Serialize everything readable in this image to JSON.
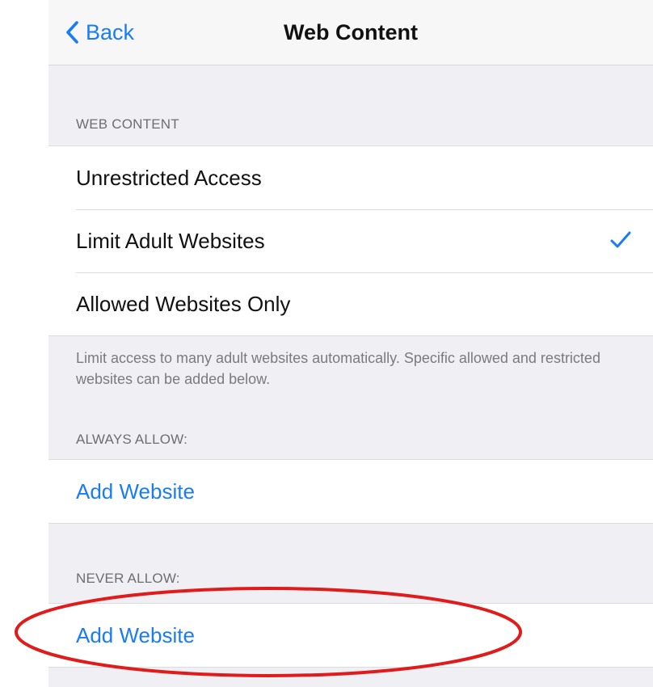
{
  "navbar": {
    "back_label": "Back",
    "title": "Web Content"
  },
  "web_content": {
    "header": "WEB CONTENT",
    "options": [
      {
        "label": "Unrestricted Access",
        "selected": false
      },
      {
        "label": "Limit Adult Websites",
        "selected": true
      },
      {
        "label": "Allowed Websites Only",
        "selected": false
      }
    ],
    "footer": "Limit access to many adult websites automatically. Specific allowed and restricted websites can be added below."
  },
  "always_allow": {
    "header": "ALWAYS ALLOW:",
    "add_label": "Add Website"
  },
  "never_allow": {
    "header": "NEVER ALLOW:",
    "add_label": "Add Website"
  },
  "colors": {
    "accent": "#1a7cf5",
    "background": "#efeff4",
    "annotation": "#e01b1b"
  },
  "icons": {
    "back": "chevron-left-icon",
    "selected": "checkmark-icon"
  }
}
